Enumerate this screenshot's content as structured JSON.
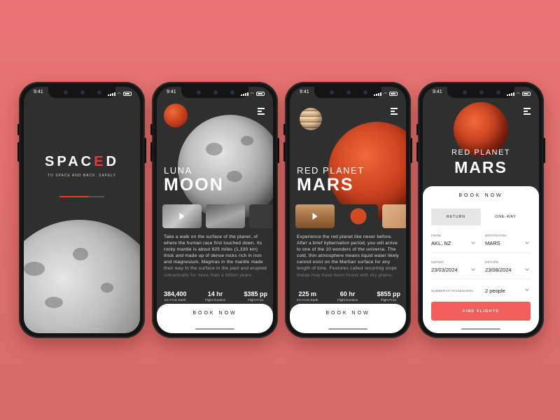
{
  "status": {
    "time": "9:41"
  },
  "splash": {
    "logo_pre": "SPAC",
    "logo_accent": "E",
    "logo_post": "D",
    "tagline": "TO SPACE AND BACK, SAFELY",
    "loading_progress": 0.65
  },
  "moon_screen": {
    "subtitle": "LUNA",
    "title": "MOON",
    "description": "Take a walk on the surface of the planet, of where the human race first touched down. Its rocky mantle is about 825 miles (1,330 km) thick and made up of dense rocks rich in iron and magnesium. Magmas in the mantle made their way to the surface in the past and erupted volcanically for more than a billion years.",
    "stats": [
      {
        "value": "384,400",
        "label": "Km From Earth"
      },
      {
        "value": "14 hr",
        "label": "Flight Duration"
      },
      {
        "value": "$385 pp",
        "label": "Flight Price"
      }
    ],
    "book_label": "BOOK NOW"
  },
  "mars_screen": {
    "subtitle": "RED PLANET",
    "title": "MARS",
    "description": "Experience the red planet like never before. After a brief hybernation period, you will arrive to one of the 10 wonders of the universe. The cold, thin atmosphere means liquid water likely cannot exist on the Martian surface for any length of time. Features called recurring slope lineae may have been found with dry grains.",
    "stats": [
      {
        "value": "225 m",
        "label": "Km From Earth"
      },
      {
        "value": "60 hr",
        "label": "Flight Duration"
      },
      {
        "value": "$855 pp",
        "label": "Flight Price"
      }
    ],
    "book_label": "BOOK NOW"
  },
  "booking_screen": {
    "subtitle": "RED PLANET",
    "title": "MARS",
    "form_title": "BOOK NOW",
    "trip_types": [
      "RETURN",
      "ONE-WAY"
    ],
    "selected_trip": "RETURN",
    "from": {
      "label": "FROM",
      "value": "AKL, NZ"
    },
    "destination": {
      "label": "DESTINATION",
      "value": "MARS"
    },
    "depart": {
      "label": "DEPART",
      "value": "23/03/2024"
    },
    "return": {
      "label": "RETURN",
      "value": "23/08/2024"
    },
    "passengers": {
      "label": "NUMBER OF PASSENGERS",
      "value": "2 people"
    },
    "submit_label": "FIND FLIGHTS"
  },
  "colors": {
    "background": "#e87573",
    "accent_red": "#e53935",
    "button": "#f25e5c",
    "screen_dark": "#2f2f2f"
  }
}
